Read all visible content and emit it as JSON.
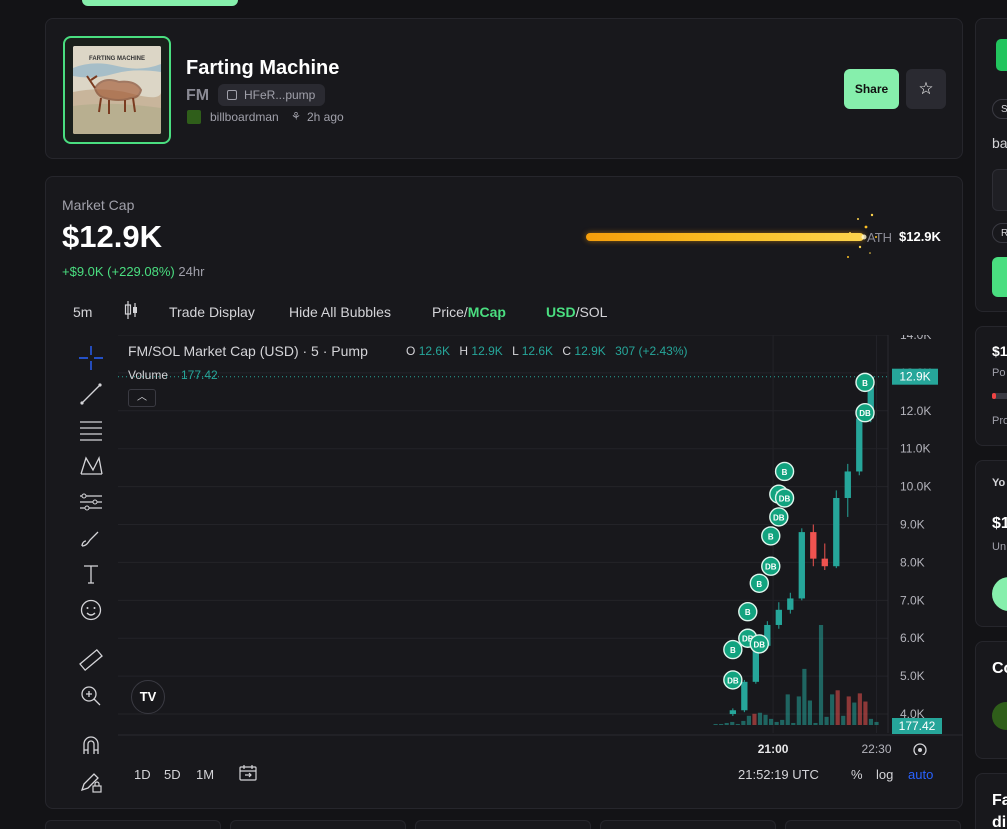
{
  "token": {
    "name": "Farting Machine",
    "ticker": "FM",
    "image_caption": "FARTING MACHINE",
    "contract_short": "HFeR...pump",
    "creator": "billboardman",
    "age": "2h ago",
    "share_label": "Share",
    "favorite_icon": "star-icon"
  },
  "market": {
    "label": "Market Cap",
    "value": "$12.9K",
    "change_abs": "+$9.0K (+229.08%)",
    "change_period": "24hr",
    "ath_label": "ATH",
    "ath_value": "$12.9K",
    "ath_progress": 1.0,
    "bar_color": "#f5a623"
  },
  "toolbar": {
    "interval": "5m",
    "trade_display": "Trade Display",
    "hide_bubbles": "Hide All Bubbles",
    "price_label": "Price",
    "price_sep": "/",
    "mcap_label": "MCap",
    "usd_label": "USD",
    "usd_sep": "/",
    "sol_label": "SOL"
  },
  "legend": {
    "title": "FM/SOL Market Cap (USD) · 5 · Pump",
    "o_key": "O",
    "o": "12.6K",
    "h_key": "H",
    "h": "12.9K",
    "l_key": "L",
    "l": "12.6K",
    "c_key": "C",
    "c": "12.9K",
    "change": "307 (+2.43%)",
    "volume_label": "Volume",
    "volume_value": "177.42"
  },
  "bottom_bar": {
    "ranges": [
      "1D",
      "5D",
      "1M"
    ],
    "time": "21:52:19 UTC",
    "percent": "%",
    "log": "log",
    "auto": "auto"
  },
  "chart_data": {
    "type": "candlestick",
    "y_ticks": [
      "14.0K",
      "13.0K",
      "12.0K",
      "11.0K",
      "10.0K",
      "9.0K",
      "8.0K",
      "7.0K",
      "6.0K",
      "5.0K",
      "4.0K"
    ],
    "y_tick_values": [
      14000,
      13000,
      12000,
      11000,
      10000,
      9000,
      8000,
      7000,
      6000,
      5000,
      4000
    ],
    "ylim": [
      3500,
      14000
    ],
    "x_ticks": [
      "21:00",
      "22:30"
    ],
    "x_tick_index": [
      3.5,
      12.5
    ],
    "xlim": [
      -53.5,
      13.5
    ],
    "current_price_label": "12.9K",
    "current_price": 12900,
    "current_volume_label": "177.42",
    "up_color": "#26a69a",
    "down_color": "#ef5350",
    "candles": [
      {
        "o": 4000,
        "h": 4150,
        "l": 3950,
        "c": 4100
      },
      {
        "o": 4100,
        "h": 4900,
        "l": 4050,
        "c": 4850
      },
      {
        "o": 4850,
        "h": 5900,
        "l": 4800,
        "c": 5800
      },
      {
        "o": 5800,
        "h": 6450,
        "l": 5750,
        "c": 6350
      },
      {
        "o": 6350,
        "h": 6950,
        "l": 6250,
        "c": 6750
      },
      {
        "o": 6750,
        "h": 7200,
        "l": 6650,
        "c": 7050
      },
      {
        "o": 7050,
        "h": 8900,
        "l": 7000,
        "c": 8800
      },
      {
        "o": 8800,
        "h": 9000,
        "l": 7900,
        "c": 8100
      },
      {
        "o": 8100,
        "h": 8500,
        "l": 7800,
        "c": 7900
      },
      {
        "o": 7900,
        "h": 9900,
        "l": 7850,
        "c": 9700
      },
      {
        "o": 9700,
        "h": 10600,
        "l": 9200,
        "c": 10400
      },
      {
        "o": 10400,
        "h": 12000,
        "l": 10300,
        "c": 11800
      },
      {
        "o": 11800,
        "h": 12950,
        "l": 11700,
        "c": 12900
      }
    ],
    "volume_units": "relative",
    "volumes": [
      {
        "v": 1,
        "up": true
      },
      {
        "v": 1,
        "up": true
      },
      {
        "v": 2,
        "up": true
      },
      {
        "v": 3,
        "up": true
      },
      {
        "v": 1,
        "up": true
      },
      {
        "v": 4,
        "up": true
      },
      {
        "v": 9,
        "up": true
      },
      {
        "v": 11,
        "up": false
      },
      {
        "v": 12,
        "up": true
      },
      {
        "v": 10,
        "up": true
      },
      {
        "v": 6,
        "up": true
      },
      {
        "v": 3,
        "up": true
      },
      {
        "v": 5,
        "up": true
      },
      {
        "v": 30,
        "up": true
      },
      {
        "v": 2,
        "up": true
      },
      {
        "v": 28,
        "up": true
      },
      {
        "v": 55,
        "up": true
      },
      {
        "v": 24,
        "up": true
      },
      {
        "v": 2,
        "up": true
      },
      {
        "v": 98,
        "up": true
      },
      {
        "v": 8,
        "up": true
      },
      {
        "v": 30,
        "up": true
      },
      {
        "v": 34,
        "up": false
      },
      {
        "v": 9,
        "up": true
      },
      {
        "v": 28,
        "up": false
      },
      {
        "v": 22,
        "up": true
      },
      {
        "v": 31,
        "up": false
      },
      {
        "v": 23,
        "up": false
      },
      {
        "v": 6,
        "up": true
      },
      {
        "v": 3,
        "up": true
      }
    ],
    "volume_x_index": [
      -1.5,
      12.5
    ],
    "bubbles": [
      {
        "label": "B",
        "i": 0,
        "y": 5700
      },
      {
        "label": "DB",
        "i": 0,
        "y": 4900
      },
      {
        "label": "B",
        "i": 1.3,
        "y": 6700
      },
      {
        "label": "DB",
        "i": 1.3,
        "y": 6000
      },
      {
        "label": "DB",
        "i": 2.3,
        "y": 5850
      },
      {
        "label": "B",
        "i": 2.3,
        "y": 7450
      },
      {
        "label": "DB",
        "i": 3.3,
        "y": 7900
      },
      {
        "label": "B",
        "i": 3.3,
        "y": 8700
      },
      {
        "label": "DB",
        "i": 4.0,
        "y": 9200
      },
      {
        "label": "B",
        "i": 4.0,
        "y": 9800
      },
      {
        "label": "DB",
        "i": 4.5,
        "y": 9700
      },
      {
        "label": "B",
        "i": 4.5,
        "y": 10400
      },
      {
        "label": "DB",
        "i": 11.5,
        "y": 11950
      },
      {
        "label": "B",
        "i": 11.5,
        "y": 12750
      }
    ]
  },
  "side": {
    "s1a": "S",
    "s1b": "ba",
    "s1c": "R",
    "s2a": "$1",
    "s2b": "Po",
    "s2c": "Pro",
    "s3a": "Yo",
    "s3b": "$1",
    "s3c": "Un",
    "s4a": "Co",
    "s5a": "Fa",
    "s5b": "di"
  }
}
